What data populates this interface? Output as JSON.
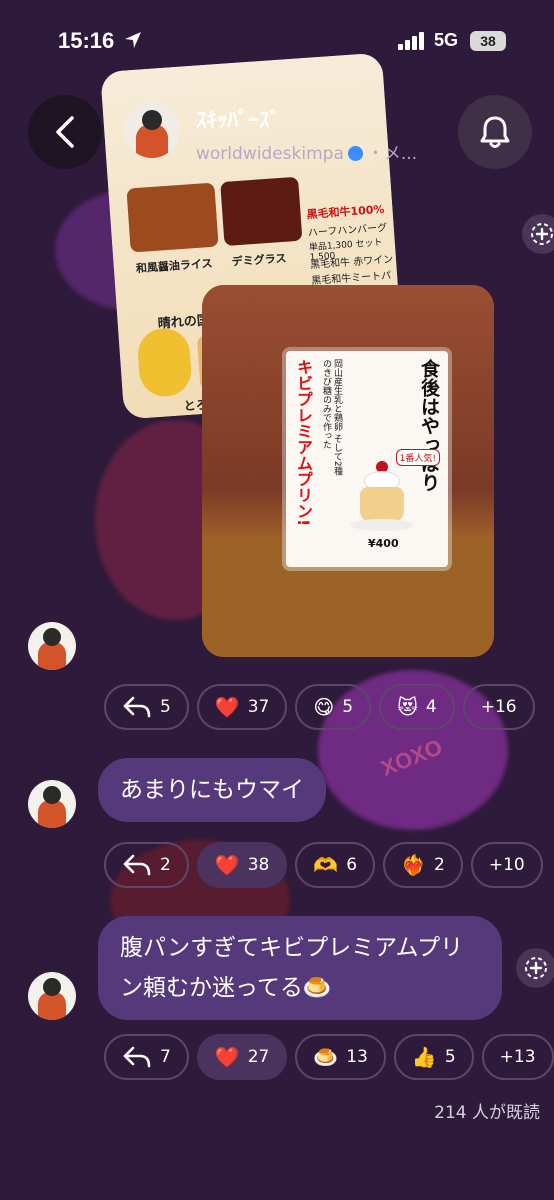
{
  "status_bar": {
    "time": "15:16",
    "network": "5G",
    "battery": "38"
  },
  "header": {
    "name": "ｽｷｯﾊﾟｰｽﾞ",
    "handle": "worldwideskimpa",
    "sub_suffix": "・メ..."
  },
  "photos": {
    "menu_card": {
      "badge": "黒毛和牛100%",
      "dish1": "和風醤油ライス",
      "dish2": "デミグラス",
      "price1": "単品1,300 セット1,500",
      "price2": "黒毛和牛 赤ワイン",
      "price3": "ハーフハンバーグ",
      "price4": "黒毛和牛ミートパイ",
      "footer": "晴れの国あっ晴れ",
      "footer2": "とろ～り ふわ"
    },
    "pudding_sign": {
      "headline": "食後はやっぱり",
      "vertical": "キビプレミアムプリン!",
      "body": "岡山産生乳と鶏卵 そして2種のきび糖のみで作った",
      "tag": "1番人気!",
      "price": "¥400"
    }
  },
  "messages": [
    {
      "text": "",
      "reactions": [
        {
          "icon": "reply-icon",
          "symbol": "",
          "count": "5",
          "active": false
        },
        {
          "icon": "heart-icon",
          "symbol": "❤️",
          "count": "37",
          "active": false
        },
        {
          "icon": "smile-icon",
          "symbol": "😋",
          "count": "5",
          "active": false
        },
        {
          "icon": "heart-eyes-cat-icon",
          "symbol": "😻",
          "count": "4",
          "active": false
        },
        {
          "icon": "more-reactions",
          "symbol": "",
          "count": "+16",
          "active": false
        }
      ]
    },
    {
      "text": "あまりにもウマイ",
      "reactions": [
        {
          "icon": "reply-icon",
          "symbol": "",
          "count": "2",
          "active": false
        },
        {
          "icon": "heart-icon",
          "symbol": "❤️",
          "count": "38",
          "active": true
        },
        {
          "icon": "heart-hands-icon",
          "symbol": "🫶",
          "count": "6",
          "active": false
        },
        {
          "icon": "heart-on-fire-icon",
          "symbol": "❤️‍🔥",
          "count": "2",
          "active": false
        },
        {
          "icon": "more-reactions",
          "symbol": "",
          "count": "+10",
          "active": false
        }
      ]
    },
    {
      "text": "腹パンすぎてキビプレミアムプリン頼むか迷ってる🍮",
      "reactions": [
        {
          "icon": "reply-icon",
          "symbol": "",
          "count": "7",
          "active": false
        },
        {
          "icon": "heart-icon",
          "symbol": "❤️",
          "count": "27",
          "active": true
        },
        {
          "icon": "pudding-icon",
          "symbol": "🍮",
          "count": "13",
          "active": false
        },
        {
          "icon": "thumbs-up-icon",
          "symbol": "👍",
          "count": "5",
          "active": false
        },
        {
          "icon": "more-reactions",
          "symbol": "",
          "count": "+13",
          "active": false
        }
      ]
    }
  ],
  "read_receipt": "214 人が既読",
  "decor": {
    "xoxo": "XOXO"
  }
}
